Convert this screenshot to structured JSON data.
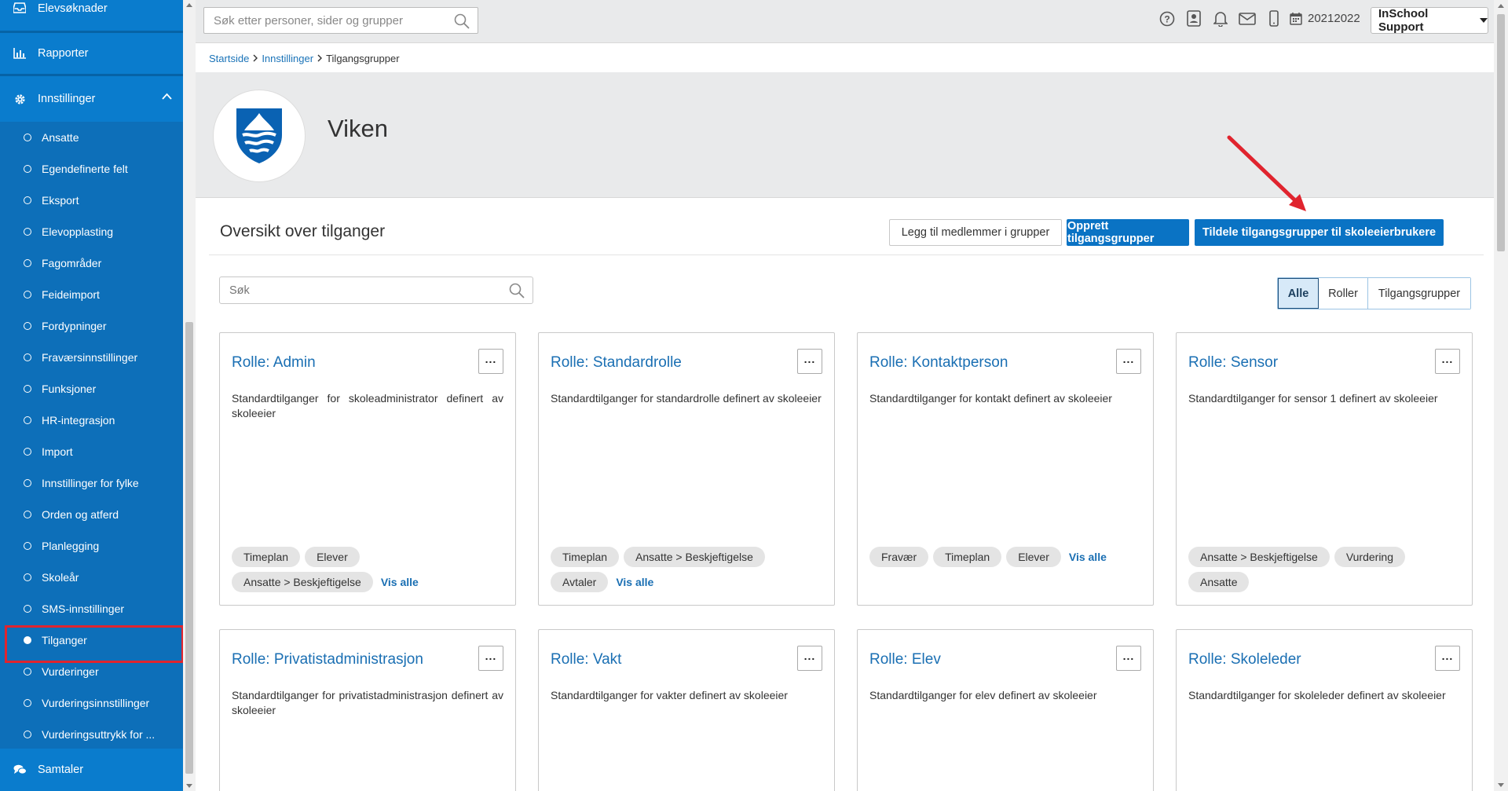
{
  "sidebar": {
    "top_items": [
      {
        "label": "Elevsøknader",
        "icon": "inbox-icon"
      },
      {
        "label": "Rapporter",
        "icon": "bar-chart-icon"
      }
    ],
    "section": {
      "label": "Innstillinger",
      "icon": "gear-icon"
    },
    "items": [
      {
        "label": "Ansatte"
      },
      {
        "label": "Egendefinerte felt"
      },
      {
        "label": "Eksport"
      },
      {
        "label": "Elevopplasting"
      },
      {
        "label": "Fagområder"
      },
      {
        "label": "Feideimport"
      },
      {
        "label": "Fordypninger"
      },
      {
        "label": "Fraværsinnstillinger"
      },
      {
        "label": "Funksjoner"
      },
      {
        "label": "HR-integrasjon"
      },
      {
        "label": "Import"
      },
      {
        "label": "Innstillinger for fylke"
      },
      {
        "label": "Orden og atferd"
      },
      {
        "label": "Planlegging"
      },
      {
        "label": "Skoleår"
      },
      {
        "label": "SMS-innstillinger"
      },
      {
        "label": "Tilganger"
      },
      {
        "label": "Vurderinger"
      },
      {
        "label": "Vurderingsinnstillinger"
      },
      {
        "label": "Vurderingsuttrykk for ..."
      }
    ],
    "active_item": "Tilganger",
    "bottom_item": {
      "label": "Samtaler",
      "icon": "chat-icon"
    }
  },
  "topbar": {
    "search_placeholder": "Søk etter personer, sider og grupper",
    "year": "20212022",
    "user": "InSchool Support"
  },
  "breadcrumb": {
    "items": [
      "Startside",
      "Innstillinger"
    ],
    "current": "Tilgangsgrupper"
  },
  "header": {
    "org_name": "Viken"
  },
  "main": {
    "title": "Oversikt over tilganger",
    "buttons": {
      "add_members": "Legg til medlemmer i grupper",
      "create_groups": "Opprett tilgangsgrupper",
      "assign_groups": "Tildele tilgangsgrupper til skoleeierbrukere"
    },
    "search_placeholder": "Søk",
    "filters": [
      "Alle",
      "Roller",
      "Tilgangsgrupper"
    ],
    "active_filter": "Alle",
    "more_label": "Vis alle",
    "cards": [
      {
        "title": "Rolle: Admin",
        "desc": "Standardtilganger for skoleadministrator definert av skoleeier",
        "tags": [
          "Timeplan",
          "Elever",
          "Ansatte > Beskjeftigelse"
        ],
        "show_more": true
      },
      {
        "title": "Rolle: Standardrolle",
        "desc": "Standardtilganger for standardrolle definert av skoleeier",
        "tags": [
          "Timeplan",
          "Ansatte > Beskjeftigelse",
          "Avtaler"
        ],
        "show_more": true
      },
      {
        "title": "Rolle: Kontaktperson",
        "desc": "Standardtilganger for kontakt definert av skoleeier",
        "tags": [
          "Fravær",
          "Timeplan",
          "Elever"
        ],
        "show_more": true
      },
      {
        "title": "Rolle: Sensor",
        "desc": "Standardtilganger for sensor 1 definert av skoleeier",
        "tags": [
          "Ansatte > Beskjeftigelse",
          "Vurdering",
          "Ansatte"
        ],
        "show_more": false
      },
      {
        "title": "Rolle: Privatistadministrasjon",
        "desc": "Standardtilganger for privatistadministrasjon definert av skoleeier",
        "tags": [],
        "show_more": false
      },
      {
        "title": "Rolle: Vakt",
        "desc": "Standardtilganger for vakter definert av skoleeier",
        "tags": [],
        "show_more": false
      },
      {
        "title": "Rolle: Elev",
        "desc": "Standardtilganger for elev definert av skoleeier",
        "tags": [],
        "show_more": false
      },
      {
        "title": "Rolle: Skoleleder",
        "desc": "Standardtilganger for skoleleder definert av skoleeier",
        "tags": [],
        "show_more": false
      }
    ]
  },
  "colors": {
    "sidebar_bg": "#0a7ccd",
    "primary_button": "#0a73c4",
    "link": "#1a6fb3",
    "highlight_box": "#e0242e",
    "arrow": "#e0242e"
  }
}
